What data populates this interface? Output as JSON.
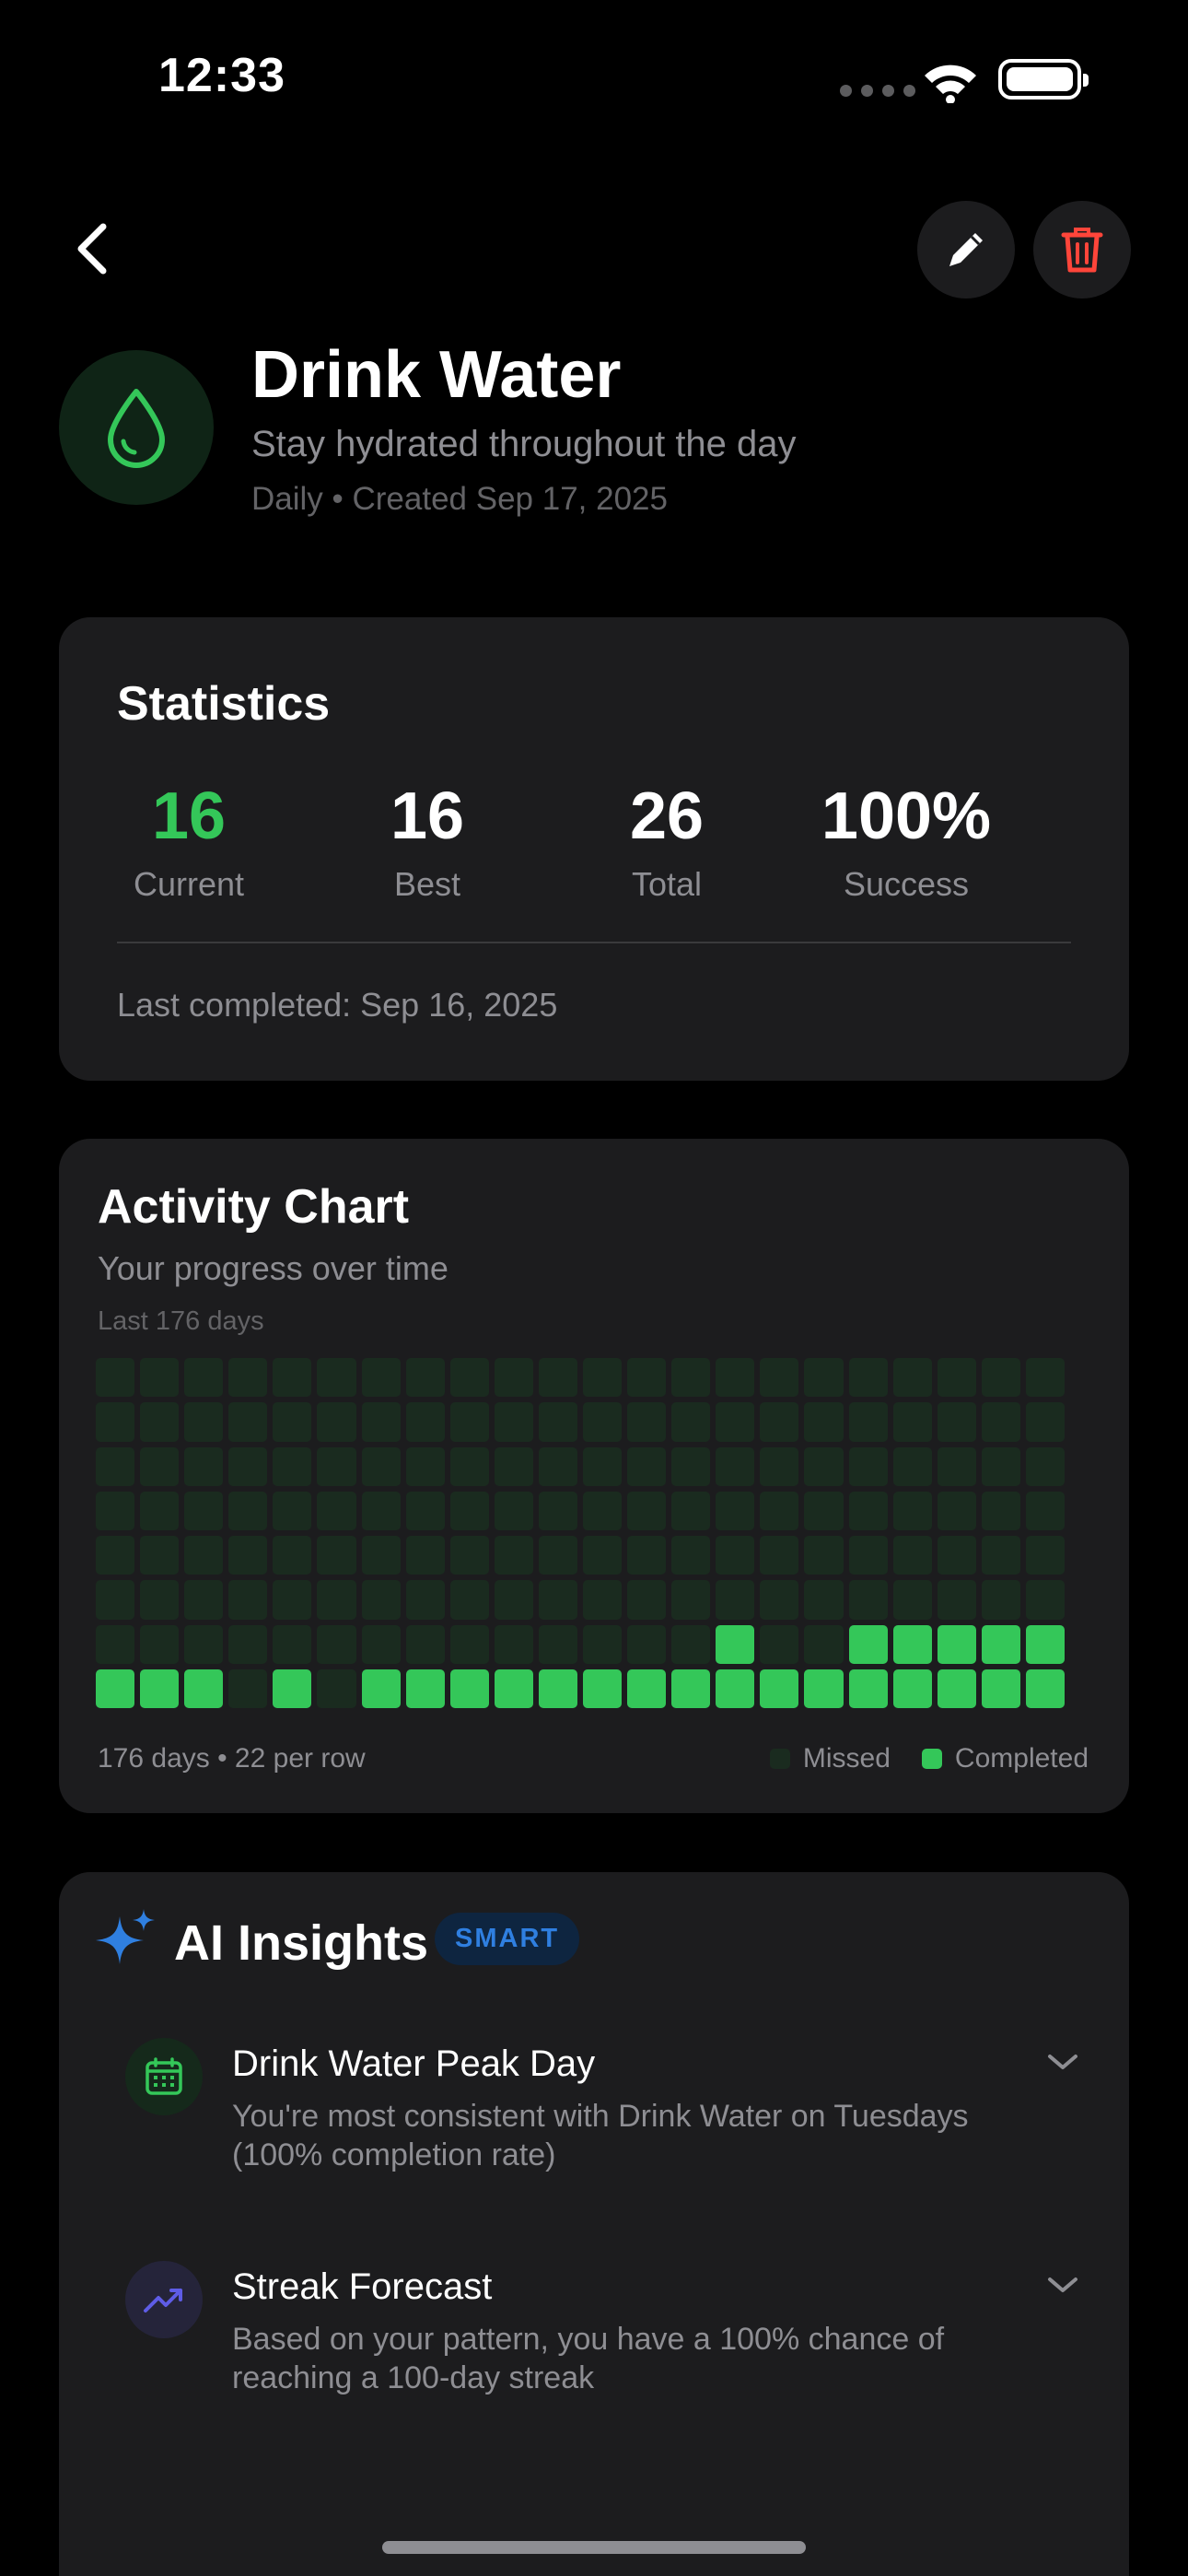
{
  "status_bar": {
    "time": "12:33"
  },
  "habit": {
    "title": "Drink Water",
    "subtitle": "Stay hydrated throughout the day",
    "meta": "Daily • Created Sep 17, 2025",
    "icon": "water-drop-icon",
    "accent": "#34c759"
  },
  "statistics": {
    "title": "Statistics",
    "items": [
      {
        "value": "16",
        "label": "Current",
        "color": "#34c759"
      },
      {
        "value": "16",
        "label": "Best",
        "color": "#ffffff"
      },
      {
        "value": "26",
        "label": "Total",
        "color": "#ffffff"
      },
      {
        "value": "100%",
        "label": "Success",
        "color": "#ffffff"
      }
    ],
    "last_completed": "Last completed: Sep 16, 2025"
  },
  "activity_chart": {
    "title": "Activity Chart",
    "subtitle": "Your progress over time",
    "range_label": "Last 176 days",
    "footer": "176 days • 22 per row",
    "legend_missed": "Missed",
    "legend_completed": "Completed",
    "colors": {
      "missed": "#1a2b1f",
      "completed": "#34c759"
    }
  },
  "chart_data": {
    "type": "heatmap",
    "columns": 22,
    "rows": 8,
    "completed": [
      [
        0,
        0,
        0,
        0,
        0,
        0,
        0,
        0,
        0,
        0,
        0,
        0,
        0,
        0,
        0,
        0,
        0,
        0,
        0,
        0,
        0,
        0
      ],
      [
        0,
        0,
        0,
        0,
        0,
        0,
        0,
        0,
        0,
        0,
        0,
        0,
        0,
        0,
        0,
        0,
        0,
        0,
        0,
        0,
        0,
        0
      ],
      [
        0,
        0,
        0,
        0,
        0,
        0,
        0,
        0,
        0,
        0,
        0,
        0,
        0,
        0,
        0,
        0,
        0,
        0,
        0,
        0,
        0,
        0
      ],
      [
        0,
        0,
        0,
        0,
        0,
        0,
        0,
        0,
        0,
        0,
        0,
        0,
        0,
        0,
        0,
        0,
        0,
        0,
        0,
        0,
        0,
        0
      ],
      [
        0,
        0,
        0,
        0,
        0,
        0,
        0,
        0,
        0,
        0,
        0,
        0,
        0,
        0,
        0,
        0,
        0,
        0,
        0,
        0,
        0,
        0
      ],
      [
        0,
        0,
        0,
        0,
        0,
        0,
        0,
        0,
        0,
        0,
        0,
        0,
        0,
        0,
        0,
        0,
        0,
        0,
        0,
        0,
        0,
        0
      ],
      [
        0,
        0,
        0,
        0,
        0,
        0,
        0,
        0,
        0,
        0,
        0,
        0,
        0,
        0,
        1,
        0,
        0,
        1,
        1,
        1,
        1,
        1
      ],
      [
        1,
        1,
        1,
        0,
        1,
        0,
        1,
        1,
        1,
        1,
        1,
        1,
        1,
        1,
        1,
        1,
        1,
        1,
        1,
        1,
        1,
        1
      ]
    ]
  },
  "ai_insights": {
    "title": "AI Insights",
    "badge": "SMART",
    "items": [
      {
        "title": "Drink Water Peak Day",
        "description": "You're most consistent with Drink Water on Tuesdays (100% completion rate)",
        "icon": "calendar-icon",
        "icon_color": "#34c759",
        "icon_bg": "#15291b"
      },
      {
        "title": "Streak Forecast",
        "description": "Based on your pattern, you have a 100% chance of reaching a 100-day streak",
        "icon": "trend-up-icon",
        "icon_color": "#5e5ce6",
        "icon_bg": "#25243a"
      }
    ]
  }
}
